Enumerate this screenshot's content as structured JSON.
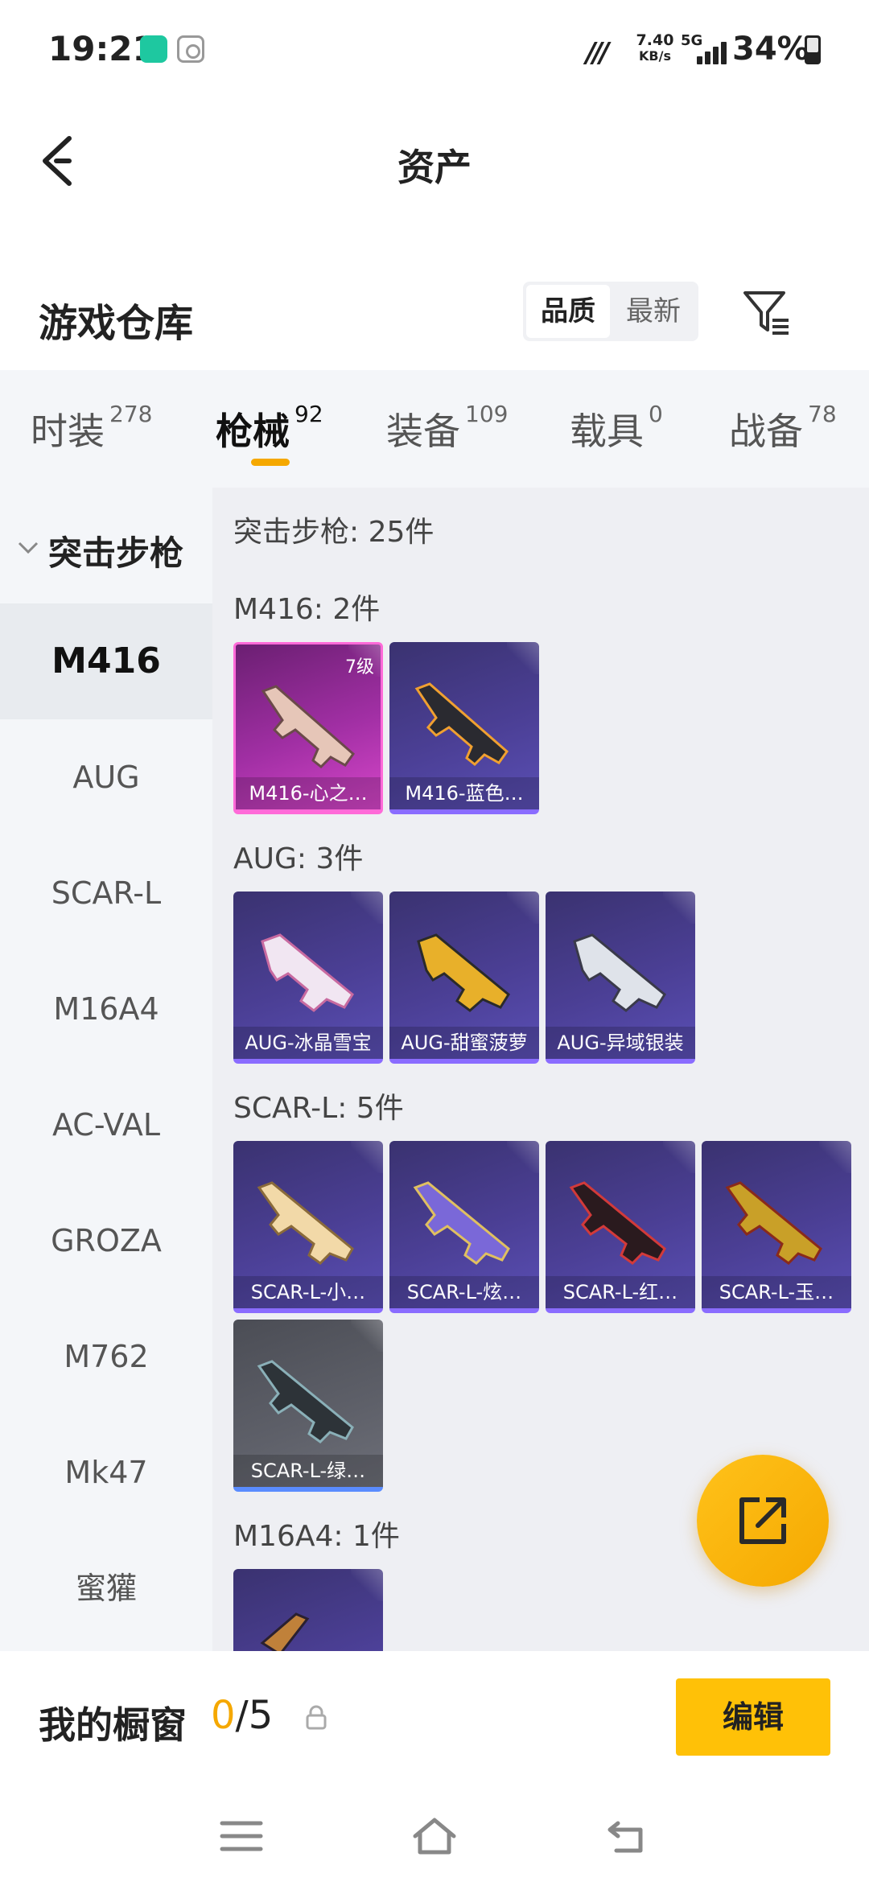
{
  "status_bar": {
    "time": "19:21",
    "speed_value": "7.40",
    "speed_unit": "KB/s",
    "network": "5G",
    "battery": "34%"
  },
  "header": {
    "title": "资产"
  },
  "warehouse": {
    "title": "游戏仓库",
    "sort_options": [
      "品质",
      "最新"
    ],
    "sort_selected": "品质"
  },
  "tabs": [
    {
      "label": "时装",
      "count": "278"
    },
    {
      "label": "枪械",
      "count": "92"
    },
    {
      "label": "装备",
      "count": "109"
    },
    {
      "label": "载具",
      "count": "0"
    },
    {
      "label": "战备",
      "count": "78"
    }
  ],
  "active_tab": "枪械",
  "sidebar": {
    "category": "突击步枪",
    "items": [
      "M416",
      "AUG",
      "SCAR-L",
      "M16A4",
      "AC-VAL",
      "GROZA",
      "M762",
      "Mk47",
      "蜜獾"
    ],
    "selected": "M416"
  },
  "content": {
    "total": "突击步枪: 25件",
    "sections": [
      {
        "title": "M416: 2件",
        "items": [
          {
            "name": "M416-心之…",
            "level": "7级",
            "color": "pink"
          },
          {
            "name": "M416-蓝色…",
            "color": "purple"
          }
        ]
      },
      {
        "title": "AUG: 3件",
        "items": [
          {
            "name": "AUG-冰晶雪宝",
            "color": "purple"
          },
          {
            "name": "AUG-甜蜜菠萝",
            "color": "purple"
          },
          {
            "name": "AUG-异域银装",
            "color": "purple"
          }
        ]
      },
      {
        "title": "SCAR-L: 5件",
        "items": [
          {
            "name": "SCAR-L-小…",
            "color": "purple"
          },
          {
            "name": "SCAR-L-炫…",
            "color": "purple"
          },
          {
            "name": "SCAR-L-红…",
            "color": "purple"
          },
          {
            "name": "SCAR-L-玉…",
            "color": "purple"
          },
          {
            "name": "SCAR-L-绿…",
            "color": "grey"
          }
        ]
      },
      {
        "title": "M16A4: 1件",
        "items": [
          {
            "name": "",
            "color": "purple"
          }
        ]
      }
    ]
  },
  "showcase": {
    "title": "我的橱窗",
    "current": "0",
    "separator": "/",
    "max": "5",
    "edit_label": "编辑"
  },
  "colors": {
    "accent": "#f5a800",
    "edit_button": "#ffc107",
    "rarity_purple": "#4b3f95",
    "rarity_pink": "#a12fa4",
    "rarity_grey": "#5e6069"
  }
}
